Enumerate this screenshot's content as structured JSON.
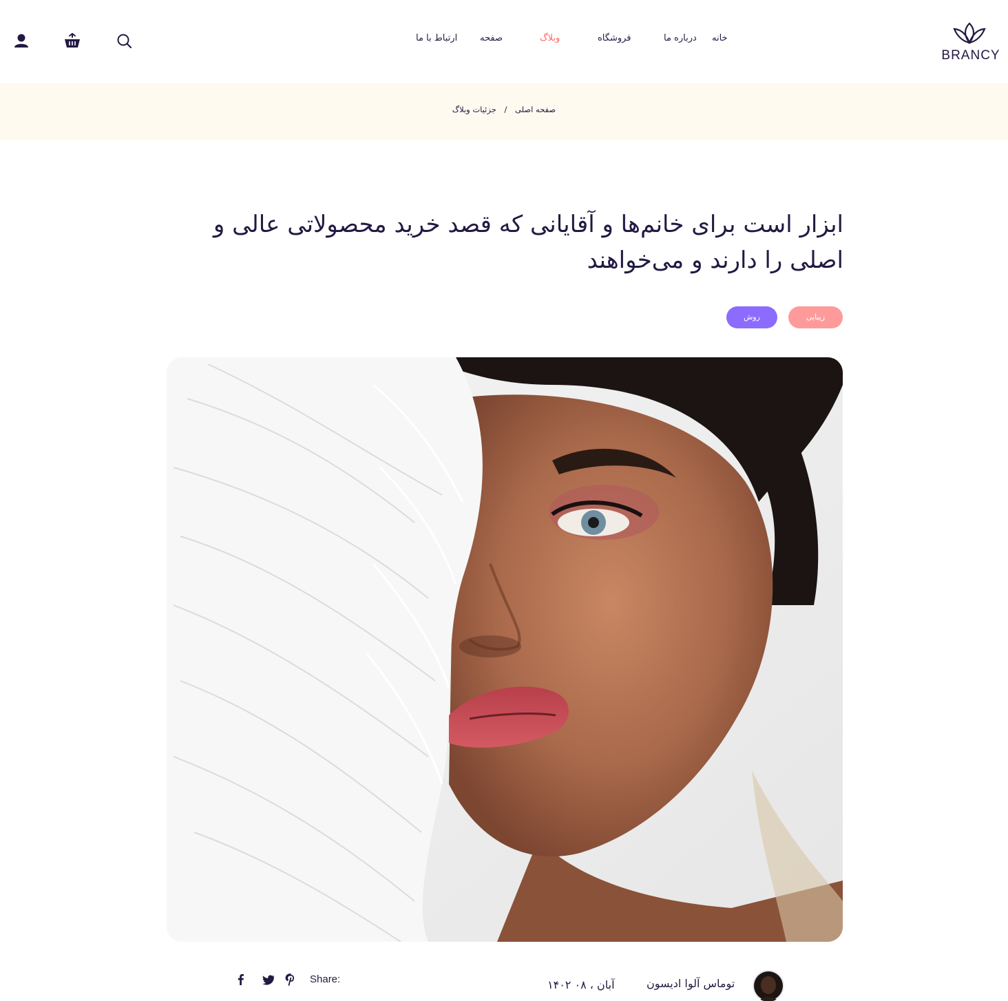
{
  "brand": {
    "name": "BRANCY",
    "accent": "#ff6565",
    "text_color": "#231942"
  },
  "nav": {
    "home": "خانه",
    "about": "درباره ما",
    "shop": "فروشگاه",
    "blog": "وبلاگ",
    "page": "صفحه",
    "contact": "ارتباط با ما"
  },
  "header_icons": [
    "search-icon",
    "basket-icon",
    "user-icon"
  ],
  "breadcrumb": {
    "home": "صفحه اصلی",
    "separator": "/",
    "current": "جزئیات وبلاگ"
  },
  "post": {
    "title": "ابزار است برای خانم‌ها و آقایانی که قصد خرید محصولاتی عالی و اصلی را دارند و می‌خواهند",
    "tags": [
      {
        "label": "زیبایی",
        "color": "#ff9a9a"
      },
      {
        "label": "روش",
        "color": "#8c6bff"
      }
    ],
    "author": "توماس آلوا ادیسون",
    "date": "آبان ، ۰۸ ۱۴۰۲",
    "share_label": "Share:",
    "share_icons": [
      "pinterest-icon",
      "twitter-icon",
      "facebook-icon"
    ]
  },
  "colors": {
    "crumb_band": "#fefaf0"
  }
}
